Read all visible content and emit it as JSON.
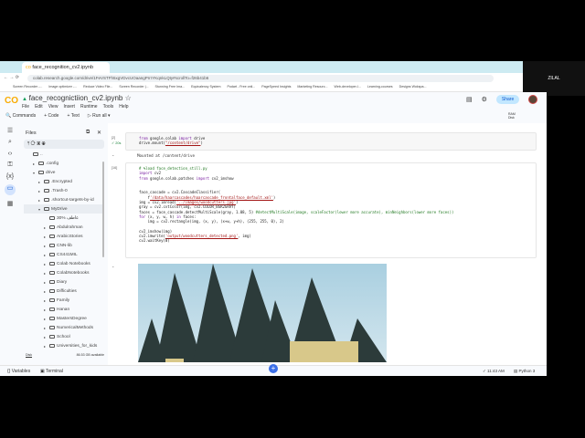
{
  "browser": {
    "tab_title": "face_recognition_cv2.ipynb",
    "url": "colab.research.google.com/drive/1FeVSTFh5xgVDvcUOaangPrrrYKqnkLQty#scrollTo=f26b41b6",
    "bookmarks": [
      "Screen Recorder -...",
      "Image optimizer -...",
      "Reduce Video File...",
      "Screen Recorder |...",
      "Stunning Free Ima...",
      "Equivalency System",
      "Podart - Free onli...",
      "PageSpeed Insights",
      "Marketing Resourc...",
      "Web-developer-l...",
      "Learning-courses",
      "Designs Wokspa..."
    ]
  },
  "camera": {
    "name": "ZILAL"
  },
  "header": {
    "logo": "CO",
    "title": "face_recognictiion_cv2.ipynb",
    "menu": [
      "File",
      "Edit",
      "View",
      "Insert",
      "Runtime",
      "Tools",
      "Help"
    ],
    "share": "Share"
  },
  "toolbar": {
    "commands": "Commands",
    "code": "+ Code",
    "text": "+ Text",
    "run_all": "Run all"
  },
  "resources": {
    "ram": "RAM",
    "disk": "Disk"
  },
  "files": {
    "title": "Files",
    "items": [
      {
        "name": "..",
        "depth": 0,
        "arrow": ""
      },
      {
        "name": ".config",
        "depth": 1,
        "arrow": "▸"
      },
      {
        "name": "drive",
        "depth": 1,
        "arrow": "▾"
      },
      {
        "name": ".Encrypted",
        "depth": 2,
        "arrow": "▸"
      },
      {
        "name": ".Trash-0",
        "depth": 2,
        "arrow": "▸"
      },
      {
        "name": ".shortcut-targets-by-id",
        "depth": 2,
        "arrow": "▸"
      },
      {
        "name": "MyDrive",
        "depth": 2,
        "arrow": "▾"
      },
      {
        "name": "30% عاطف",
        "depth": 3,
        "arrow": ""
      },
      {
        "name": "Abdulrahman",
        "depth": 3,
        "arrow": "▸"
      },
      {
        "name": "ArabicStories",
        "depth": 3,
        "arrow": "▸"
      },
      {
        "name": "CNN-lib",
        "depth": 3,
        "arrow": "▸"
      },
      {
        "name": "CS441MIL",
        "depth": 3,
        "arrow": "▸"
      },
      {
        "name": "Colab Notebooks",
        "depth": 3,
        "arrow": "▸"
      },
      {
        "name": "ColabNotebooks",
        "depth": 3,
        "arrow": "▸"
      },
      {
        "name": "Diary",
        "depth": 3,
        "arrow": "▸"
      },
      {
        "name": "Difficulties",
        "depth": 3,
        "arrow": "▸"
      },
      {
        "name": "Family",
        "depth": 3,
        "arrow": "▸"
      },
      {
        "name": "Hanan",
        "depth": 3,
        "arrow": "▸"
      },
      {
        "name": "MastersDegree",
        "depth": 3,
        "arrow": "▸"
      },
      {
        "name": "NumericalMethods",
        "depth": 3,
        "arrow": "▸"
      },
      {
        "name": "School",
        "depth": 3,
        "arrow": "▸"
      },
      {
        "name": "Universities_for_kids",
        "depth": 3,
        "arrow": "▸"
      }
    ],
    "disk_label": "Disk",
    "disk_available": "86.53 GB available"
  },
  "cells": [
    {
      "exec": "[2]",
      "time": "✓ 20s",
      "code": "from google.colab import drive\ndrive.mount(\"/content/drive\")",
      "output": "Mounted at /content/drive"
    },
    {
      "exec": "[16]",
      "code": "# %load face_detection_still.py\nimport cv2\nfrom google.colab.patches import cv2_imshow\n\n\nface_cascade = cv2.CascadeClassifier(\n    f'/data/haarcascades/haarcascade_frontalface_default.xml')\nimg = cv2.imread('../images/woodcutters.jpg')\ngray = cv2.cvtColor(img, cv2.COLOR_BGR2GRAY)\nfaces = face_cascade.detectMultiScale(gray, 1.08, 5) #detectMultiScale(image, scaleFactor(lower more accurate), minNeighbors(lower more faces))\nfor (x, y, w, h) in faces:\n    img = cv2.rectangle(img, (x, y), (x+w, y+h), (255, 255, 0), 2)\n\ncv2_imshow(img)\ncv2.imwrite('output/woodcutters_detected.png', img)\ncv2.waitKey(0)"
    }
  ],
  "status": {
    "variables": "Variables",
    "terminal": "Terminal",
    "time": "✓ 11:43 AM",
    "runtime": "Python 3"
  }
}
